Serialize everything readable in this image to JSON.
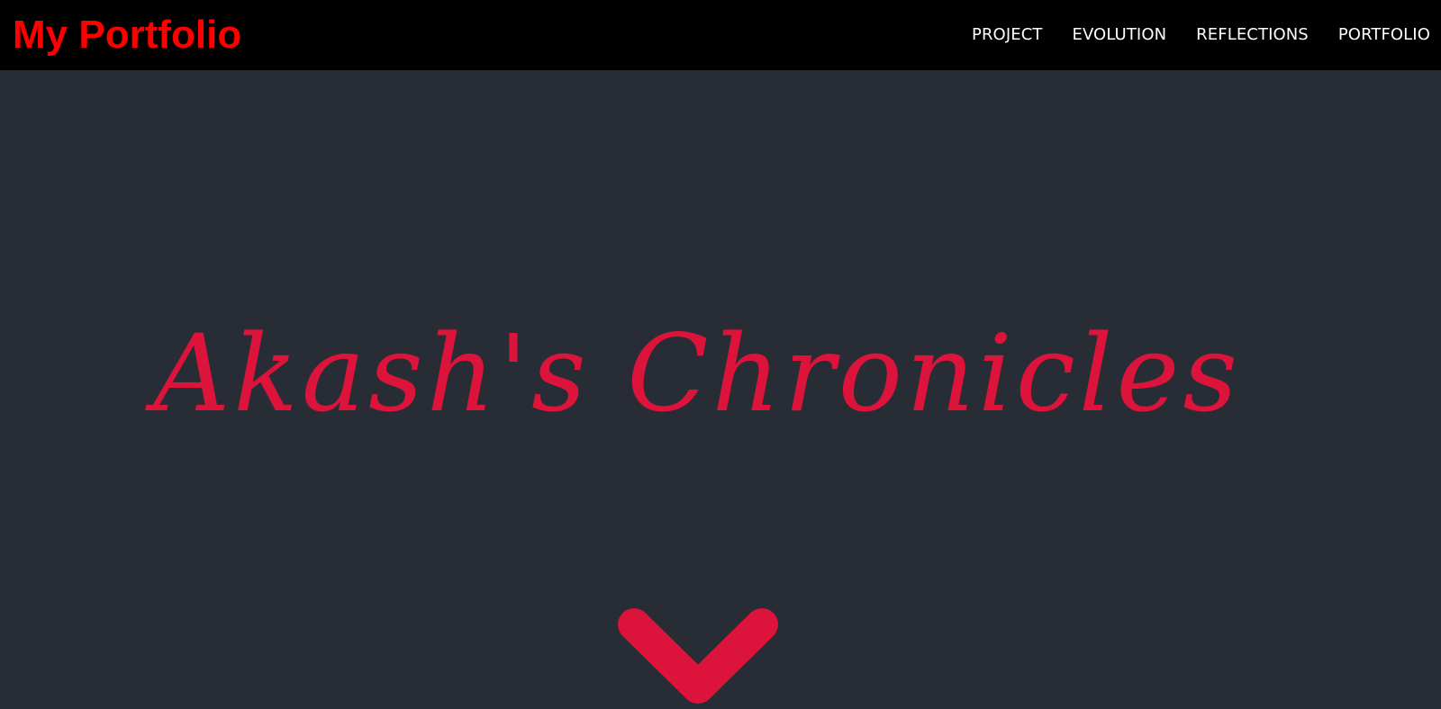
{
  "header": {
    "brand": "My Portfolio",
    "brand_color": "#ff0000",
    "background": "#000000",
    "nav": [
      {
        "label": "PROJECT"
      },
      {
        "label": "EVOLUTION"
      },
      {
        "label": "REFLECTIONS"
      },
      {
        "label": "PORTFOLIO"
      }
    ]
  },
  "hero": {
    "title": "Akash's Chronicles",
    "title_color": "#dc143c",
    "background": "#282c34",
    "scroll_icon": "chevron-down-icon"
  }
}
